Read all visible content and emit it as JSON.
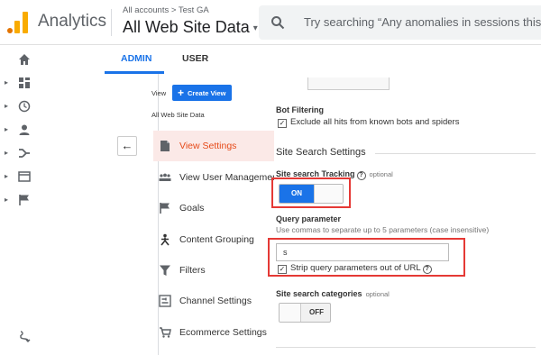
{
  "colors": {
    "accent": "#1a73e8",
    "active_text": "#e64a19",
    "active_bg": "#fbe9e7",
    "highlight_box": "#e53935",
    "logo": "#f9ab00"
  },
  "header": {
    "brand": "Analytics",
    "breadcrumb": "All accounts > Test GA",
    "view_name": "All Web Site Data",
    "view_caret": "▾",
    "search_placeholder": "Try searching “Any anomalies in sessions this"
  },
  "left_nav": {
    "items": [
      {
        "icon": "home-icon",
        "has_arrow": false
      },
      {
        "icon": "dashboard-icon",
        "has_arrow": true
      },
      {
        "icon": "clock-icon",
        "has_arrow": true
      },
      {
        "icon": "person-icon",
        "has_arrow": true
      },
      {
        "icon": "acquisition-icon",
        "has_arrow": true
      },
      {
        "icon": "behavior-icon",
        "has_arrow": true
      },
      {
        "icon": "flag-icon",
        "has_arrow": true
      }
    ],
    "bottom_icon": "discover-icon"
  },
  "tabs": [
    {
      "label": "ADMIN",
      "active": true
    },
    {
      "label": "USER",
      "active": false
    }
  ],
  "view_column": {
    "view_label": "View",
    "create_button": "Create View",
    "view_selected": "All Web Site Data",
    "back_glyph": "←",
    "menu": [
      {
        "label": "View Settings",
        "icon": "document-icon",
        "active": true
      },
      {
        "label": "View User Management",
        "icon": "people-icon",
        "active": false
      },
      {
        "label": "Goals",
        "icon": "goal-flag-icon",
        "active": false
      },
      {
        "label": "Content Grouping",
        "icon": "content-grouping-icon",
        "active": false
      },
      {
        "label": "Filters",
        "icon": "filter-icon",
        "active": false
      },
      {
        "label": "Channel Settings",
        "icon": "channel-settings-icon",
        "active": false
      },
      {
        "label": "Ecommerce Settings",
        "icon": "cart-icon",
        "active": false
      }
    ]
  },
  "settings": {
    "bot_filtering_title": "Bot Filtering",
    "bot_filtering_checkbox": "Exclude all hits from known bots and spiders",
    "bot_filtering_checked": true,
    "section_title": "Site Search Settings",
    "tracking_label": "Site search Tracking",
    "optional_label": "optional",
    "tracking_on": "ON",
    "tracking_enabled": true,
    "query_param_title": "Query parameter",
    "query_param_hint": "Use commas to separate up to 5 parameters (case insensitive)",
    "query_param_value": "s",
    "strip_checkbox": "Strip query parameters out of URL",
    "strip_checked": true,
    "categories_label": "Site search categories",
    "categories_off": "OFF",
    "categories_enabled": false,
    "help_glyph": "?",
    "check_glyph": "✓"
  }
}
